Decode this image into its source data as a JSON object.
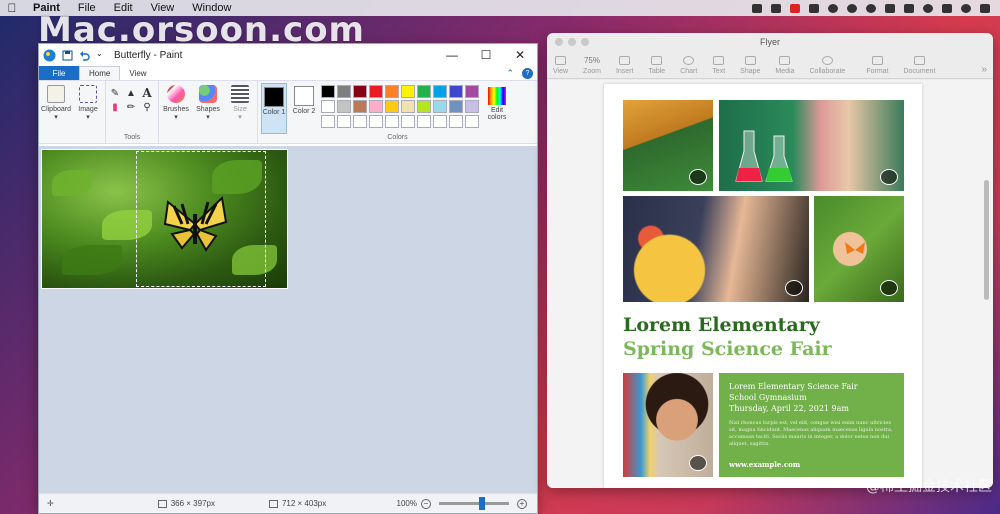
{
  "menubar": {
    "app": "Paint",
    "items": [
      "File",
      "Edit",
      "View",
      "Window"
    ]
  },
  "watermark": {
    "text": "Mac.orsoon.com",
    "bottom_right": "@稀土掘金技术社区"
  },
  "paint": {
    "title": "Butterfly - Paint",
    "tabs": {
      "file": "File",
      "home": "Home",
      "view": "View"
    },
    "ribbon": {
      "clipboard": "Clipboard",
      "image": "Image",
      "tools_label": "Tools",
      "brushes": "Brushes",
      "shapes": "Shapes",
      "size": "Size",
      "color1": "Color 1",
      "color2": "Color 2",
      "colors_label": "Colors",
      "edit_colors": "Edit colors"
    },
    "palette": [
      "#000000",
      "#7f7f7f",
      "#880015",
      "#ed1c24",
      "#ff7f27",
      "#fff200",
      "#22b14c",
      "#00a2e8",
      "#3f48cc",
      "#a349a4",
      "#ffffff",
      "#c3c3c3",
      "#b97a57",
      "#ffaec9",
      "#ffc90e",
      "#efe4b0",
      "#b5e61d",
      "#99d9ea",
      "#7092be",
      "#c8bfe7",
      "#ffffff",
      "#ffffff",
      "#ffffff",
      "#ffffff",
      "#ffffff",
      "#ffffff",
      "#ffffff",
      "#ffffff",
      "#ffffff",
      "#ffffff"
    ],
    "status": {
      "selection_size": "366 × 397px",
      "image_size": "712 × 403px",
      "zoom": "100%"
    }
  },
  "pages": {
    "title": "Flyer",
    "toolbar": {
      "view": "View",
      "zoom_value": "75%",
      "zoom": "Zoom",
      "insert": "Insert",
      "table": "Table",
      "chart": "Chart",
      "text": "Text",
      "shape": "Shape",
      "media": "Media",
      "collaborate": "Collaborate",
      "format": "Format",
      "document": "Document"
    },
    "flyer": {
      "heading1": "Lorem Elementary",
      "heading2": "Spring Science Fair",
      "box_line1": "Lorem Elementary Science Fair",
      "box_line2": "School Gymnasium",
      "box_line3": "Thursday, April 22, 2021 9am",
      "box_body": "Nisl rhoncus turpis est, vel elit, congue wisi enim nunc ultricies sit, magna tincidunt. Maecenas aliquam maecenas ligula nostra, accumsan taciti. Sociis mauris in integer, a dolor netus non dui aliquet, sagittis.",
      "url": "www.example.com"
    }
  },
  "colors": {
    "accent_blue": "#1a6dc8",
    "flyer_dark_green": "#2a6a1e",
    "flyer_light_green": "#7bb85a",
    "flyer_box_green": "#72b04a"
  }
}
